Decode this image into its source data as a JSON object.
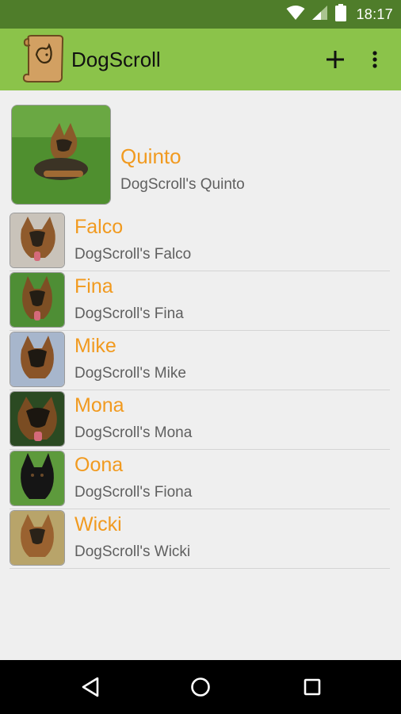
{
  "status_bar": {
    "time": "18:17",
    "icons": [
      "wifi-icon",
      "cellular-signal-icon",
      "battery-icon"
    ]
  },
  "app_bar": {
    "title": "DogScroll",
    "actions": [
      "add-icon",
      "overflow-menu-icon"
    ]
  },
  "dogs": [
    {
      "name": "Quinto",
      "subtitle": "DogScroll's Quinto"
    },
    {
      "name": "Falco",
      "subtitle": "DogScroll's Falco"
    },
    {
      "name": "Fina",
      "subtitle": "DogScroll's Fina"
    },
    {
      "name": "Mike",
      "subtitle": "DogScroll's Mike"
    },
    {
      "name": "Mona",
      "subtitle": "DogScroll's Mona"
    },
    {
      "name": "Oona",
      "subtitle": "DogScroll's Fiona"
    },
    {
      "name": "Wicki",
      "subtitle": "DogScroll's Wicki"
    }
  ],
  "nav_bar": {
    "buttons": [
      "back-icon",
      "home-icon",
      "recents-icon"
    ]
  },
  "colors": {
    "status_bar": "#4f7d2a",
    "app_bar": "#8bc34a",
    "name_text": "#f19a1f",
    "subtitle_text": "#5f5f5f",
    "background": "#efefef"
  }
}
